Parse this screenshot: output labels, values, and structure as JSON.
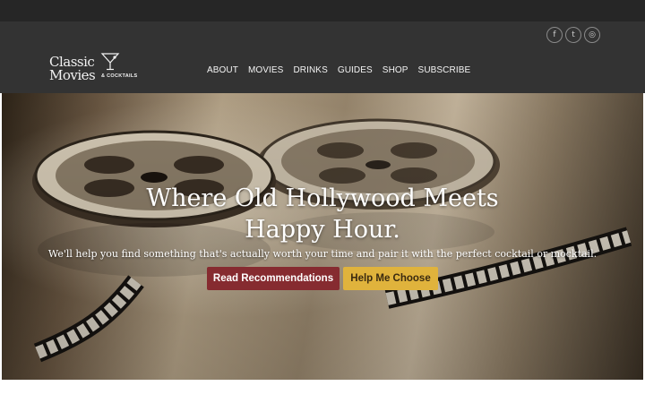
{
  "logo": {
    "line1": "Classic",
    "line2": "Movies",
    "tag": "& COCKTAILS"
  },
  "social": [
    {
      "icon": "facebook-icon",
      "glyph": "f"
    },
    {
      "icon": "twitter-icon",
      "glyph": "t"
    },
    {
      "icon": "instagram-icon",
      "glyph": "◎"
    }
  ],
  "nav": {
    "items": [
      "ABOUT",
      "MOVIES",
      "DRINKS",
      "GUIDES",
      "SHOP",
      "SUBSCRIBE"
    ]
  },
  "hero": {
    "title_line1": "Where Old Hollywood Meets",
    "title_line2": "Happy Hour.",
    "subtitle": "We'll help you find something that's actually worth your time and pair it with the perfect cocktail or mocktail.",
    "primary_button": "Read Recommendations",
    "secondary_button": "Help Me Choose"
  },
  "colors": {
    "nav_bg": "#333333",
    "top_bar": "#262626",
    "primary_btn": "#862b30",
    "secondary_btn": "#e0b33c"
  }
}
